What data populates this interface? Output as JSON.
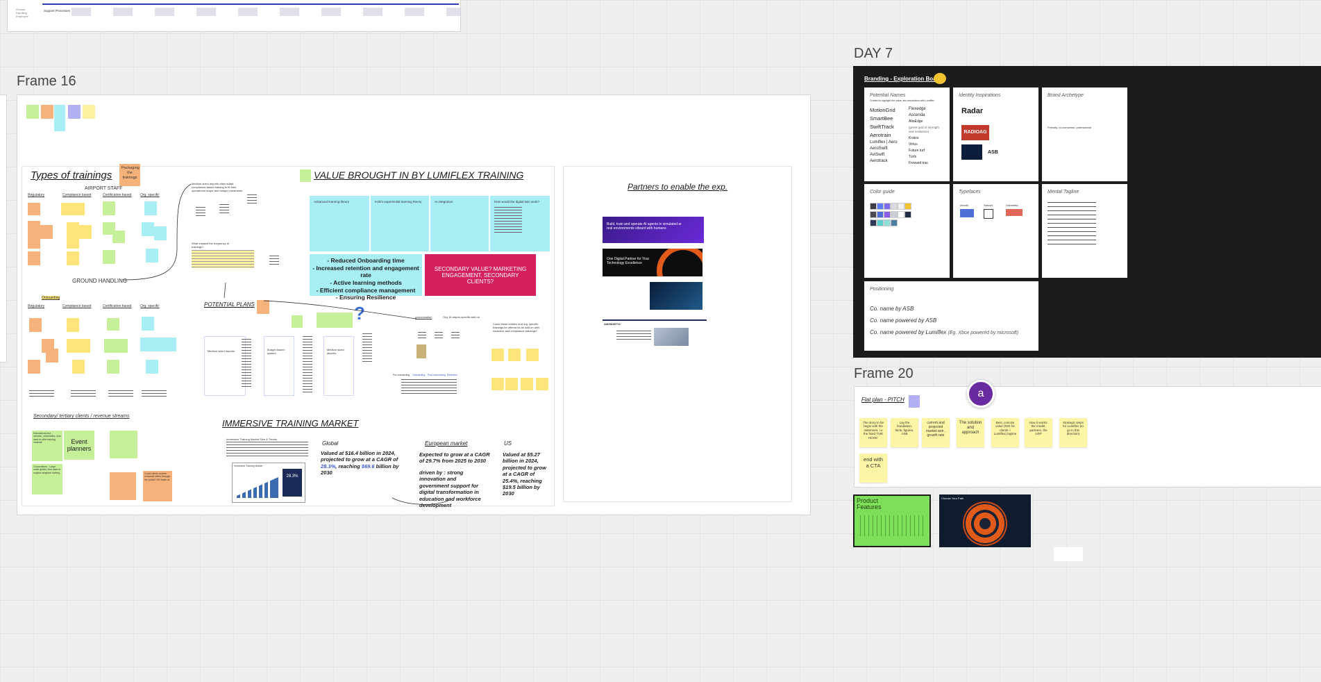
{
  "frames": {
    "frame16": "Frame 16",
    "day7": "DAY 7",
    "frame20": "Frame 20"
  },
  "top_strip": {
    "left_text_1": "Ground Handling Employee",
    "left_text_2": "Support Processes"
  },
  "trainings": {
    "title": "Types of trainings",
    "packaging_note": "Packaging the trainings",
    "subtitle": "AIRPORT STAFF",
    "columns": [
      "Regulatory",
      "Compliance based",
      "Certification based",
      "Org. specific"
    ],
    "ground_handling": "GROUND HANDLING",
    "onboarding": "Onboarding",
    "secondary_title": "Secondary/ tertiary clients / revenue streams",
    "event_planners": "Event planners",
    "col2_note_a": "Medium sized airports often adapt compliance-based training to fit their operational scope and budget constraints",
    "col2_note_b": "What impacts the frequency of trainings?",
    "potential_plans": "POTENTIAL PLANS",
    "orange_bottom": "Could clients access exclusive offers through the portal? OR trade ok",
    "yellow_bottom_1": "Educational Inst. - schools, universities, who want to offer training material",
    "yellow_bottom_2": "Corporations - Large scale global, who want to explore adaptive training"
  },
  "value": {
    "title": "VALUE BROUGHT IN BY LUMIFLEX TRAINING",
    "col_titles": [
      "Advanced learning theory",
      "Kolb's experiential learning theory",
      "AI integration",
      "How would the digital twin work?"
    ],
    "benefits": [
      "- Reduced Onboarding time",
      "- Increased retention and engagement rate",
      "- Active learning methods",
      "- Efficient compliance management",
      "- Ensuring Resilience"
    ],
    "secondary_value": "SECONDARY VALUE? MARKETING ENGAGEMENT, SECONDARY CLIENTS?"
  },
  "plans": {
    "cards": [
      "Medium sized airports",
      "Budget based system",
      "Medium sized airports"
    ],
    "ai_label": "Org. AI airport-specific add on",
    "customisation": "customisation",
    "could_offer": "Could these entities and org. specific trainings be offered as an add-on with exclusive and compliance trainings?",
    "pre_onboarding": "Pre-onboarding",
    "onboarding": "Onboarding",
    "post_onboarding": "Post-onboarding",
    "retention": "Retention"
  },
  "market": {
    "title": "IMMERSIVE TRAINING MARKET",
    "global_h": "Global",
    "global_1": "Valued at $16.4 billion in 2024, projected to grow at a CAGR of ",
    "global_cagr": "28.3%",
    "global_2": ", reaching ",
    "global_val": "$69.6",
    "global_3": " billion by 2030",
    "eu_h": "European market",
    "eu_1": "Expected to grow at a CAGR of 29.7% from 2025 to 2030",
    "eu_2": "driven by : strong innovation and government support for digital transformation in education and workforce development",
    "us_h": "US",
    "us_1": "Valued at $5.27 billion in 2024, projected to grow at a CAGR of 25.4%, reaching $19.5 billion by 2030",
    "report_title": "Immersive Training Market Size & Trends",
    "chart_label": "Immersive Training Market",
    "chart_pct": "28.3%"
  },
  "partners": {
    "title": "Partners to enable the exp.",
    "p1": "Build, train and operate AI agents in simulated or real environments vibrant with humans",
    "p2": "One Digital Partner for Your Technology Excellence",
    "p3_brand": "AMSMARTIC"
  },
  "branding": {
    "title": "Branding - Exploration Board",
    "names_title": "Potential Names",
    "names_desc": "Created to highlight the value, and association with Lumiflex",
    "names_col1": [
      "MotionGrid",
      "SmartBee",
      "SwiftTrack",
      "Aerotrain",
      "Lumiflex | Aero",
      "AeroSwift",
      "AviSwift",
      "Aerotrack"
    ],
    "names_col2": [
      "Flexedge",
      "Ascenda",
      "AltaEdge",
      "(greek god of strength and resilience)",
      "Kratos",
      "Virtus",
      "Future turf",
      "Turfx",
      "Forward trac"
    ],
    "identity_title": "Identity Inspirations",
    "logos": [
      "Radar",
      "RADIOAG",
      "ASB"
    ],
    "archetype_title": "Brand Archetype",
    "archetype_text": "Friendly, no-nonsense, professional",
    "color_title": "Color guide",
    "swatches": [
      "#3d3d4a",
      "#5c7cf0",
      "#7b6ee8",
      "#d9dbe0",
      "#f0f0f0",
      "#f2c230",
      "#4a4a55",
      "#4f6ed8",
      "#8a5ce8",
      "#c9cdd4",
      "#ffffff",
      "#1f2d45",
      "#2b3a55",
      "#5ad0c8",
      "#8fe0d8",
      "#4b7fa0"
    ],
    "typefaces_title": "Typefaces",
    "fonts": [
      "Aeonik",
      "Satoshi",
      "Gambetta"
    ],
    "mental_title": "Mental Tagline",
    "positioning_title": "Positioning",
    "positioning": [
      "Co. name by ASB",
      "Co. name powered by ASB",
      "Co. name powered by Lumiflex"
    ],
    "positioning_eg": "(Eg. Xbox powered by microsoft)"
  },
  "pitch": {
    "title": "Flat plan - PITCH",
    "avatar": "a",
    "notes": [
      "The story to be begin with the statement, i.e the fixed 'THE HOOK'",
      "Lay the foundation, facts, figures, ASB",
      "current and projected market size , growth rate",
      "The solution and approach",
      "Best, concise value (ROI for clients + Lumiflex) tagline",
      "How it works: the model, partners, the USP",
      "Strategic steps for Lumiflex (to go in this direction)",
      "end with a CTA"
    ]
  },
  "bottom": {
    "product_features": "Product Features",
    "choose_path": "Choose Your Path"
  },
  "colors": {
    "canvas": "#efefef",
    "orange": "#f5b27a",
    "yellow": "#fde57a",
    "green": "#c6ef9a",
    "cyan": "#a7eef5",
    "pink": "#d61f5e",
    "purple": "#6a2aa0",
    "dark": "#1c1c1c"
  }
}
